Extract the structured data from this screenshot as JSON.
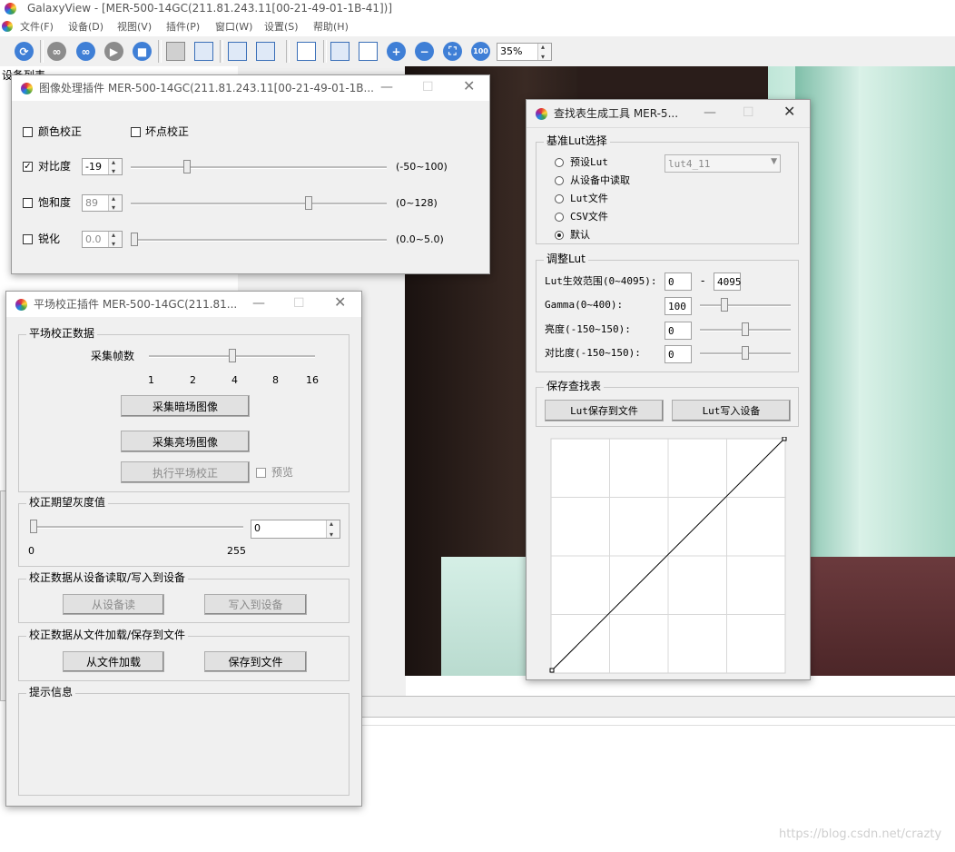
{
  "app": {
    "title": "GalaxyView - [MER-500-14GC(211.81.243.11[00-21-49-01-1B-41])]"
  },
  "menu": [
    "文件(F)",
    "设备(D)",
    "视图(V)",
    "插件(P)",
    "窗口(W)",
    "设置(S)",
    "帮助(H)"
  ],
  "toolbar": {
    "zoom_value": "35%",
    "zoom_100_label": "100"
  },
  "background": {
    "device_list_label": "设备列表"
  },
  "image_plugin": {
    "title": "图像处理插件  MER-500-14GC(211.81.243.11[00-21-49-01-1B...",
    "color_correction_label": "颜色校正",
    "bad_pixel_label": "坏点校正",
    "contrast_label": "对比度",
    "contrast_value": "-19",
    "contrast_range": "(-50~100)",
    "saturation_label": "饱和度",
    "saturation_value": "89",
    "saturation_range": "(0~128)",
    "sharpen_label": "锐化",
    "sharpen_value": "0.0",
    "sharpen_range": "(0.0~5.0)",
    "contrast_checked": true,
    "contrast_level": 0.21,
    "saturation_level": 0.7,
    "sharpen_level": 0.0
  },
  "ffc_plugin": {
    "title": "平场校正插件  MER-500-14GC(211.81...",
    "data_group_label": "平场校正数据",
    "frames_label": "采集帧数",
    "frame_ticks": [
      "1",
      "2",
      "4",
      "8",
      "16"
    ],
    "frame_selected_index": 2,
    "capture_dark_btn": "采集暗场图像",
    "capture_bright_btn": "采集亮场图像",
    "execute_btn": "执行平场校正",
    "preview_label": "预览",
    "expected_group_label": "校正期望灰度值",
    "expected_value": "0",
    "expected_min": "0",
    "expected_max": "255",
    "device_rw_group_label": "校正数据从设备读取/写入到设备",
    "read_from_device_btn": "从设备读",
    "write_to_device_btn": "写入到设备",
    "file_group_label": "校正数据从文件加载/保存到文件",
    "load_from_file_btn": "从文件加载",
    "save_to_file_btn": "保存到文件",
    "info_group_label": "提示信息"
  },
  "lut_tool": {
    "title": "查找表生成工具  MER-5...",
    "base_group_label": "基准Lut选择",
    "options": [
      "预设Lut",
      "从设备中读取",
      "Lut文件",
      "CSV文件",
      "默认"
    ],
    "selected_option_index": 4,
    "preset_select_value": "lut4_11",
    "adjust_group_label": "调整Lut",
    "range_label": "Lut生效范围(0~4095):",
    "range_from": "0",
    "range_dash": "-",
    "range_to": "4095",
    "gamma_label": "Gamma(0~400):",
    "gamma_value": "100",
    "gamma_level": 0.25,
    "brightness_label": "亮度(-150~150):",
    "brightness_value": "0",
    "brightness_level": 0.5,
    "contrast_label": "对比度(-150~150):",
    "contrast_value": "0",
    "contrast_level": 0.5,
    "save_group_label": "保存查找表",
    "save_to_file_btn": "Lut保存到文件",
    "write_to_device_btn": "Lut写入设备"
  },
  "watermark": "https://blog.csdn.net/crazty"
}
